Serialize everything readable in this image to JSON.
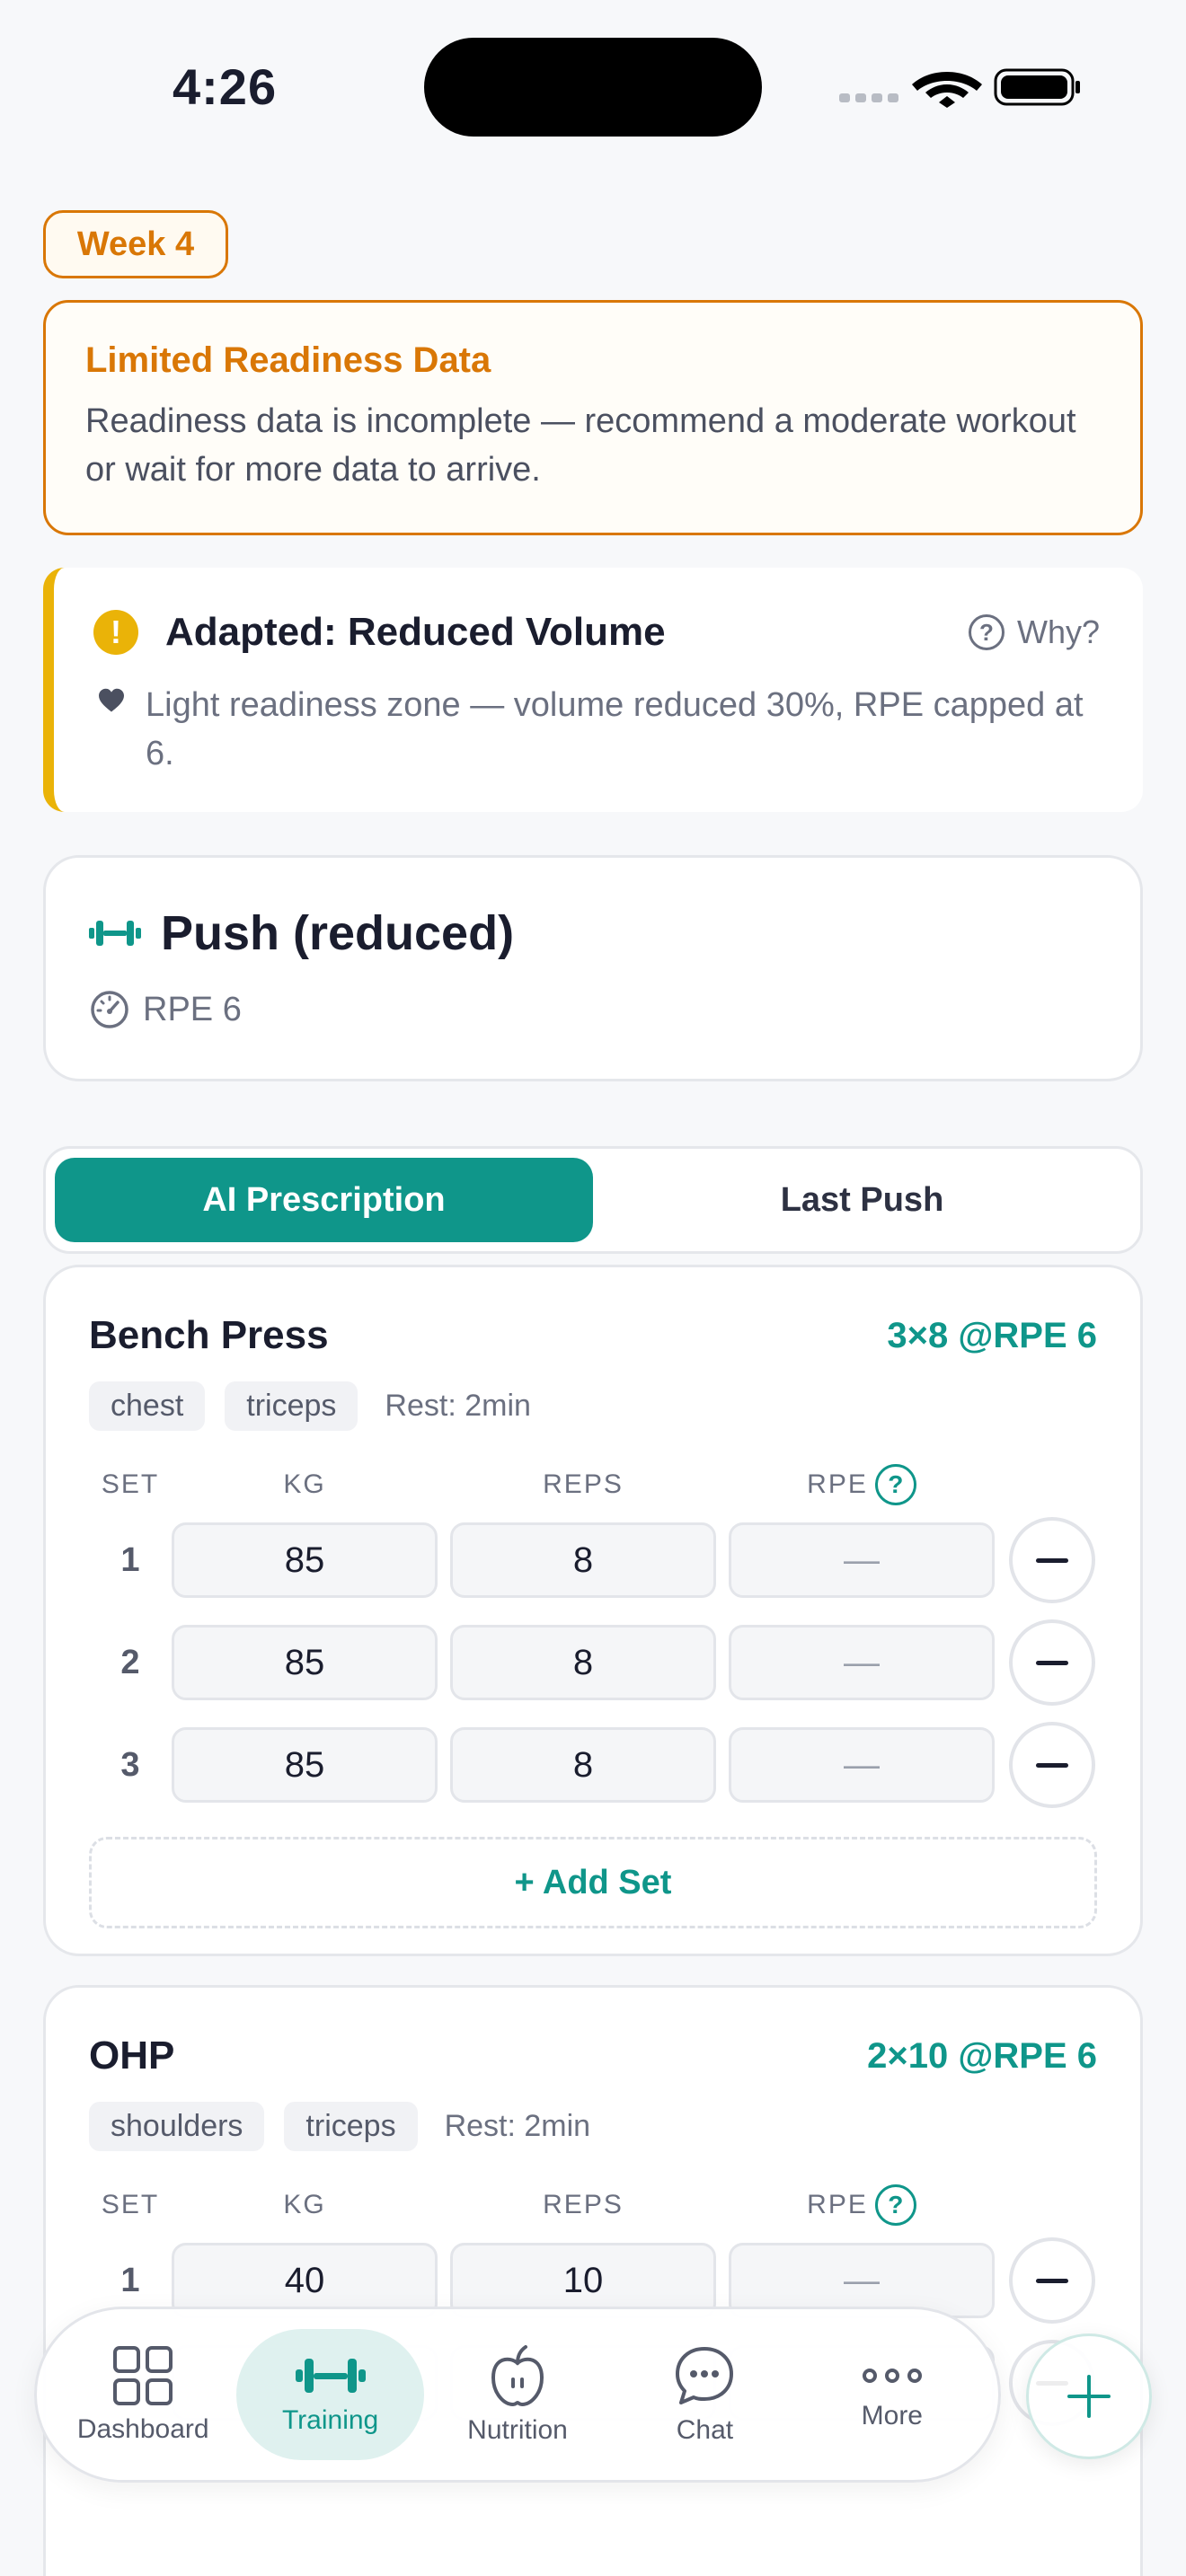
{
  "status_bar": {
    "time": "4:26"
  },
  "week_badge": "Week 4",
  "readiness_warning": {
    "title": "Limited Readiness Data",
    "text": "Readiness data is incomplete — recommend a moderate workout or wait for more data to arrive."
  },
  "adapted": {
    "alert_symbol": "!",
    "title": "Adapted: Reduced Volume",
    "why_label": "Why?",
    "why_symbol": "?",
    "text": "Light readiness zone — volume reduced 30%, RPE capped at 6."
  },
  "workout": {
    "title": "Push (reduced)",
    "rpe": "RPE 6"
  },
  "segment": {
    "tabs": [
      "AI Prescription",
      "Last Push"
    ],
    "active": 0
  },
  "set_columns": {
    "set": "SET",
    "kg": "KG",
    "reps": "REPS",
    "rpe": "RPE",
    "help": "?"
  },
  "exercises": [
    {
      "name": "Bench Press",
      "prescription": "3×8 @RPE 6",
      "tags": [
        "chest",
        "triceps"
      ],
      "rest": "Rest: 2min",
      "sets": [
        {
          "num": "1",
          "kg": "85",
          "reps": "8",
          "rpe": "—"
        },
        {
          "num": "2",
          "kg": "85",
          "reps": "8",
          "rpe": "—"
        },
        {
          "num": "3",
          "kg": "85",
          "reps": "8",
          "rpe": "—"
        }
      ],
      "add_set_label": "+ Add Set"
    },
    {
      "name": "OHP",
      "prescription": "2×10 @RPE 6",
      "tags": [
        "shoulders",
        "triceps"
      ],
      "rest": "Rest: 2min",
      "sets": [
        {
          "num": "1",
          "kg": "40",
          "reps": "10",
          "rpe": "—"
        }
      ]
    }
  ],
  "tabbar": {
    "items": [
      {
        "label": "Dashboard",
        "icon": "grid-icon"
      },
      {
        "label": "Training",
        "icon": "dumbbell-icon"
      },
      {
        "label": "Nutrition",
        "icon": "apple-icon"
      },
      {
        "label": "Chat",
        "icon": "chat-bubble-icon"
      },
      {
        "label": "More",
        "icon": "more-dots-icon"
      }
    ],
    "active": 1
  },
  "colors": {
    "accent": "#0f968a",
    "warning": "#d97706",
    "caution": "#eab308"
  }
}
